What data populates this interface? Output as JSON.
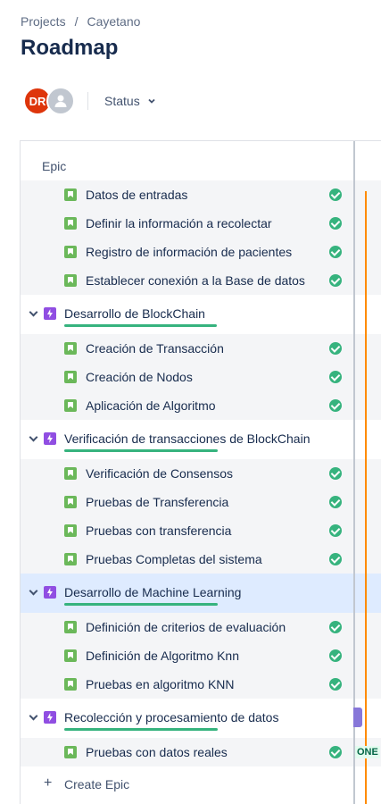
{
  "breadcrumb": {
    "projects": "Projects",
    "separator": "/",
    "project": "Cayetano"
  },
  "page": {
    "title": "Roadmap"
  },
  "filters": {
    "avatar_initials": "DR",
    "status_label": "Status"
  },
  "panel": {
    "header": "Epic"
  },
  "rows": {
    "c0": "Datos de entradas",
    "c1": "Definir la información a recolectar",
    "c2": "Registro de información de pacientes",
    "c3": "Establecer conexión a la Base de datos",
    "e1": "Desarrollo de BlockChain",
    "c4": "Creación de Transacción",
    "c5": "Creación de Nodos",
    "c6": "Aplicación de Algoritmo",
    "e2": "Verificación de transacciones de BlockChain",
    "c7": "Verificación de Consensos",
    "c8": "Pruebas de Transferencia",
    "c9": "Pruebas con transferencia",
    "c10": "Pruebas Completas del sistema",
    "e3": "Desarrollo de Machine Learning",
    "c11": "Definición de criterios de evaluación",
    "c12": "Definición de Algoritmo Knn",
    "c13": "Pruebas en algoritmo KNN",
    "e4": "Recolección y procesamiento de datos",
    "c14": "Pruebas con datos reales",
    "create": "Create Epic"
  },
  "timeline": {
    "done_lozenge": "ONE"
  },
  "colors": {
    "today_line": "#ff8b00",
    "epic": "#904ee2",
    "story": "#6bb85a",
    "done": "#36b37e",
    "selected_row": "#deebff"
  },
  "icons": [
    "chevron-down-icon",
    "epic-icon",
    "story-icon",
    "done-check-icon",
    "plus-icon",
    "user-icon"
  ]
}
